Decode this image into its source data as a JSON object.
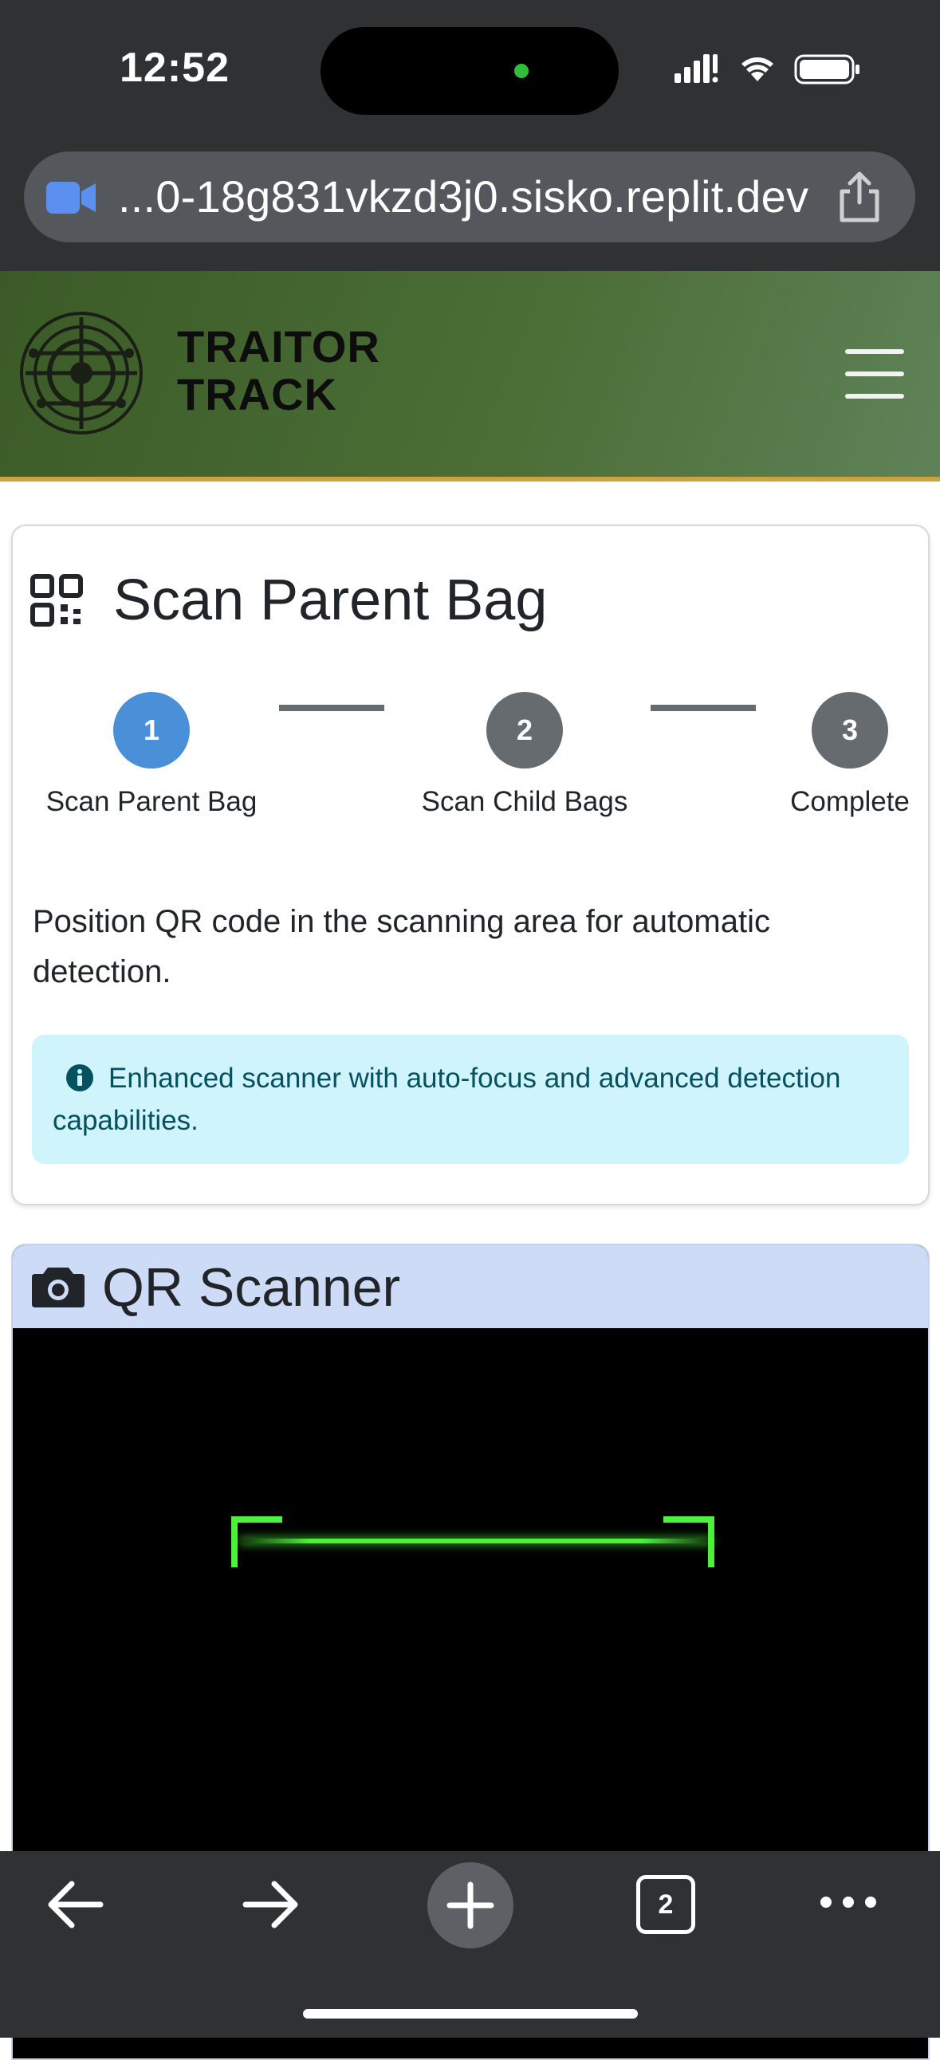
{
  "status_bar": {
    "time": "12:52",
    "icons": [
      "signal-icon",
      "wifi-icon",
      "battery-icon"
    ]
  },
  "browser": {
    "url": "...0-18g831vkzd3j0.sisko.replit.dev",
    "tab_count": "2"
  },
  "header": {
    "brand_line1": "TRAITOR",
    "brand_line2": "TRACK",
    "colors": {
      "header_green": "#4b6e36",
      "accent_gold": "#c9a33f"
    }
  },
  "scan_card": {
    "title": "Scan Parent Bag",
    "steps": [
      {
        "number": "1",
        "label": "Scan Parent Bag",
        "state": "active",
        "color": "#4a90d9"
      },
      {
        "number": "2",
        "label": "Scan Child Bags",
        "state": "pending",
        "color": "#666b70"
      },
      {
        "number": "3",
        "label": "Complete",
        "state": "pending",
        "color": "#666b70"
      }
    ],
    "instructions": "Position QR code in the scanning area for automatic detection.",
    "alert_text": "Enhanced scanner with auto-focus and advanced detection capabilities."
  },
  "scanner": {
    "title": "QR Scanner",
    "frame_color": "#4df03a"
  }
}
